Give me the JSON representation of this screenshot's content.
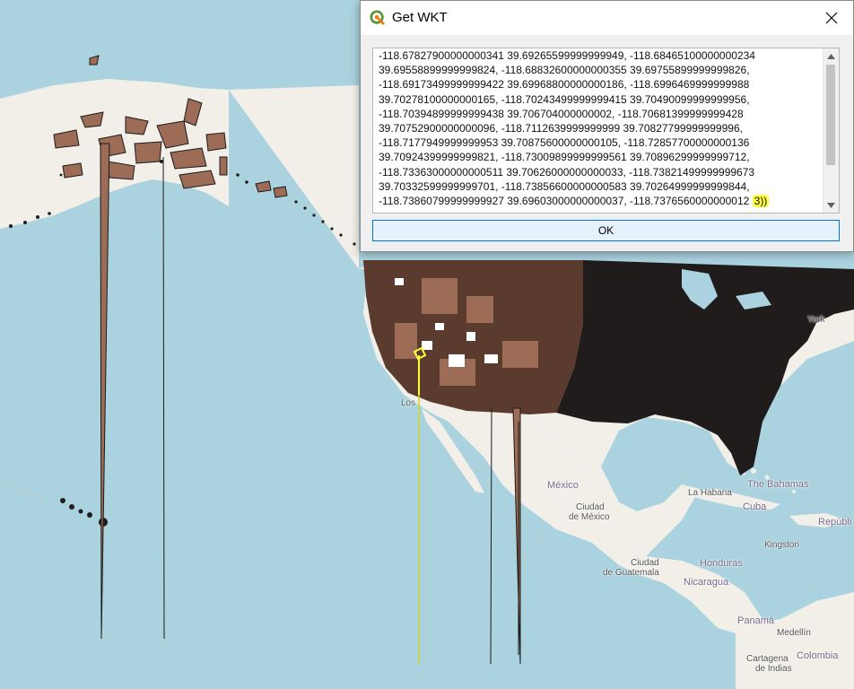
{
  "dialog": {
    "title": "Get WKT",
    "close_icon": "close-icon",
    "wkt_lines": [
      "-118.67827900000000341 39.69265599999999949, -118.68465100000000234",
      "39.69558899999999824, -118.68832600000000355 39.69755899999999826,",
      "-118.69173499999999422 39.69968800000000186, -118.6996469999999988",
      "39.70278100000000165, -118.70243499999999415 39.70490099999999956,",
      "-118.70394899999999438 39.706704000000002, -118.70681399999999428",
      "39.70752900000000096, -118.7112639999999999 39.70827799999999996,",
      "-118.7177949999999953 39.70875600000000105, -118.72857700000000136",
      "39.70924399999999821, -118.73009899999999561 39.70896299999999712,",
      "-118.73363000000000511 39.70626000000000033, -118.73821499999999673",
      "39.70332599999999701, -118.73856600000000583 39.70264999999999844,",
      "-118.73860799999999927 39.69603000000000037, -118.7376560000000012"
    ],
    "wkt_last_highlight": "3))",
    "ok_label": "OK"
  },
  "map_labels": {
    "mexico": "México",
    "ciudad_de_mexico_1": "Ciudad",
    "ciudad_de_mexico_2": "de México",
    "ciudad_de_guatemala_1": "Ciudad",
    "ciudad_de_guatemala_2": "de Guatemala",
    "honduras": "Honduras",
    "nicaragua": "Nicaragua",
    "la_habana": "La Habana",
    "cuba": "Cuba",
    "the_bahamas": "The Bahamas",
    "kingston": "Kingston",
    "republica": "Repúbli",
    "panama": "Panamá",
    "medellin": "Medellín",
    "colombia": "Colombia",
    "cartagena_1": "Cartagena",
    "cartagena_2": "de Indias",
    "los": "Los",
    "york": "York"
  },
  "colors": {
    "ocean": "#aad3df",
    "land": "#f2efe9",
    "polygon_fill": "#9c6c57",
    "dense_fill": "#1f1c1b",
    "highlight_yellow": "#ffff3c",
    "button_border": "#0078d7"
  }
}
